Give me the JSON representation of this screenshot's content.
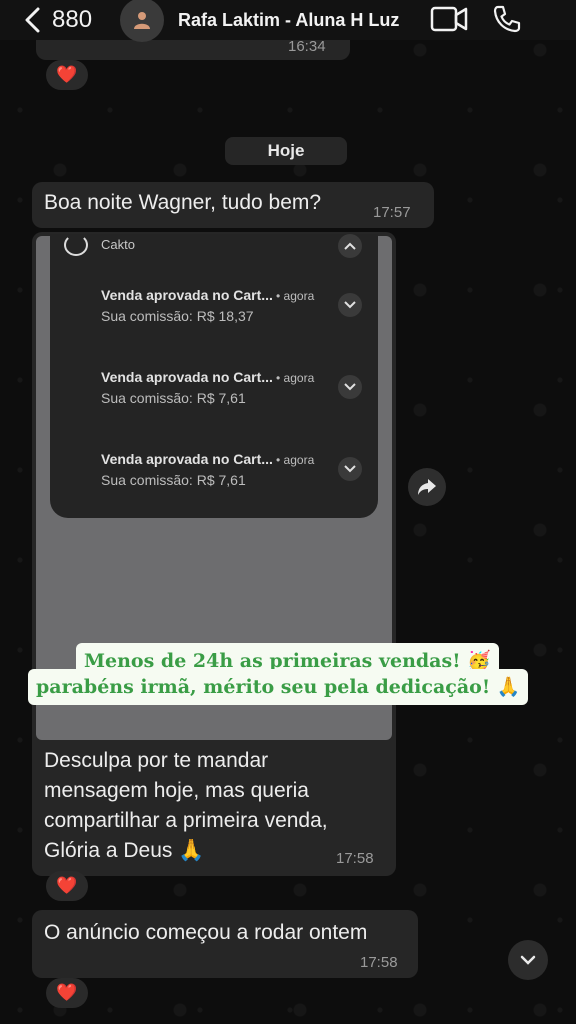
{
  "header": {
    "back_count": "880",
    "contact_name": "Rafa Laktim - Aluna H Luz"
  },
  "chat": {
    "prev_time": "16:34",
    "reaction_emoji": "❤️",
    "date_chip": "Hoje",
    "msg1": {
      "text": "Boa noite Wagner, tudo bem?",
      "time": "17:57"
    },
    "media": {
      "notification_app": "Cakto",
      "notifications": [
        {
          "title": "Venda aprovada no Cart...",
          "when": "agora",
          "sub": "Sua comissão: R$ 18,37"
        },
        {
          "title": "Venda aprovada no Cart...",
          "when": "agora",
          "sub": "Sua comissão: R$ 7,61"
        },
        {
          "title": "Venda aprovada no Cart...",
          "when": "agora",
          "sub": "Sua comissão: R$ 7,61"
        }
      ],
      "caption": [
        "Desculpa por te mandar",
        "mensagem hoje, mas queria",
        "compartilhar a primeira venda,",
        "Glória a Deus 🙏"
      ],
      "time": "17:58"
    },
    "msg3": {
      "text": "O anúncio começou a rodar ontem",
      "time": "17:58"
    }
  },
  "overlay": {
    "line1": "Menos de 24h as primeiras vendas! 🥳",
    "line2": "parabéns irmã, mérito seu pela dedicação! 🙏"
  },
  "colors": {
    "overlay_text": "#3a9d46",
    "overlay_bg": "#f6fbf2",
    "bubble": "#262626",
    "reaction_heart": "#e0143c"
  }
}
